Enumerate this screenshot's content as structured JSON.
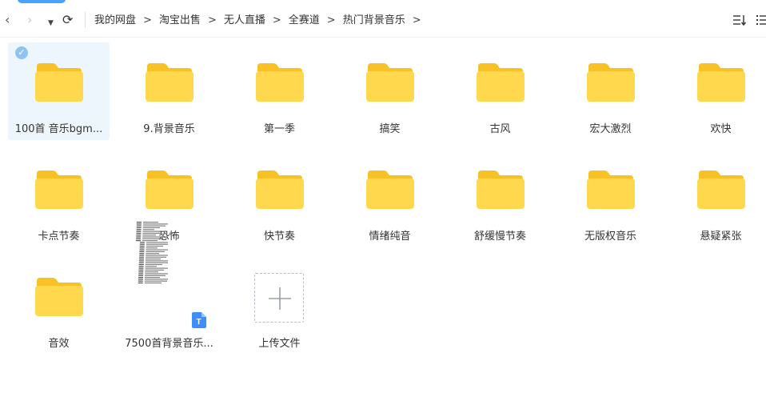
{
  "toolbar": {
    "back_glyph": "‹",
    "forward_glyph": "›",
    "dropdown_glyph": "▼",
    "refresh_glyph": "⟳"
  },
  "breadcrumb": {
    "items": [
      "我的网盘",
      "淘宝出售",
      "无人直播",
      "全赛道",
      "热门背景音乐"
    ],
    "separator": ">"
  },
  "colors": {
    "folder_body": "#FFD84D",
    "folder_tab": "#F8C227",
    "accent": "#3E8EF7",
    "selection_bg": "#EEF6FD"
  },
  "icons": {
    "sort": "sort-icon",
    "list_view": "list-view-icon",
    "folder": "folder-icon",
    "check": "check-icon",
    "plus": "plus-icon",
    "doc_badge": "document-badge-icon"
  },
  "items": [
    {
      "name": "100首 音乐bgm...",
      "type": "folder",
      "selected": true
    },
    {
      "name": "9.背景音乐",
      "type": "folder"
    },
    {
      "name": "第一季",
      "type": "folder"
    },
    {
      "name": "搞笑",
      "type": "folder"
    },
    {
      "name": "古风",
      "type": "folder"
    },
    {
      "name": "宏大激烈",
      "type": "folder"
    },
    {
      "name": "欢快",
      "type": "folder"
    },
    {
      "name": "卡点节奏",
      "type": "folder"
    },
    {
      "name": "恐怖",
      "type": "folder"
    },
    {
      "name": "快节奏",
      "type": "folder"
    },
    {
      "name": "情绪纯音",
      "type": "folder"
    },
    {
      "name": "舒缓慢节奏",
      "type": "folder"
    },
    {
      "name": "无版权音乐",
      "type": "folder"
    },
    {
      "name": "悬疑紧张",
      "type": "folder"
    },
    {
      "name": "音效",
      "type": "folder"
    },
    {
      "name": "7500首背景音乐...",
      "type": "document"
    },
    {
      "name": "上传文件",
      "type": "upload"
    }
  ],
  "doc_badge_letter": "T"
}
